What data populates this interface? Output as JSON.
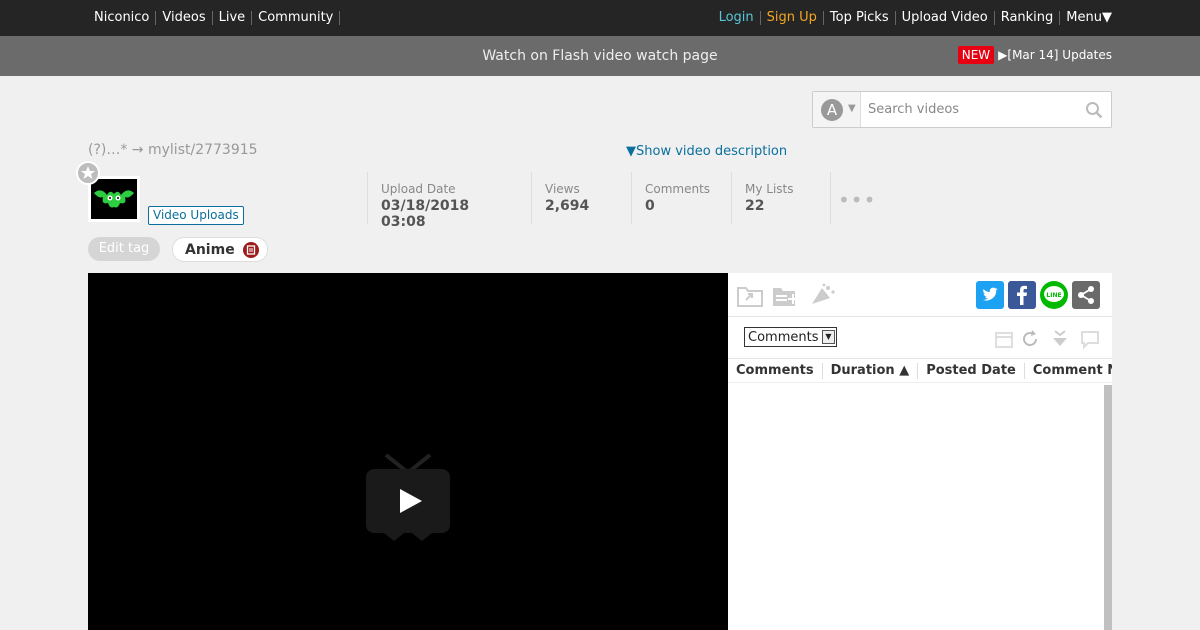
{
  "topnav": {
    "left": [
      "Niconico",
      "Videos",
      "Live",
      "Community"
    ],
    "login": "Login",
    "signup": "Sign Up",
    "right": [
      "Top Picks",
      "Upload Video",
      "Ranking",
      "Menu▼"
    ]
  },
  "subbar": {
    "flash_link": "Watch on Flash video watch page",
    "new_badge": "NEW",
    "updates": "▶[Mar 14] Updates"
  },
  "search": {
    "type_letter": "A",
    "placeholder": "Search videos"
  },
  "video": {
    "mylist_text": "(?)…* → mylist/2773915",
    "description_toggle": "▼Show video description",
    "uploads_button": "Video Uploads",
    "stats": {
      "upload_date_label": "Upload Date",
      "upload_date": "03/18/2018 03:08",
      "views_label": "Views",
      "views": "2,694",
      "comments_label": "Comments",
      "comments": "0",
      "mylists_label": "My Lists",
      "mylists": "22"
    },
    "more": "•••"
  },
  "tags": {
    "edit_label": "Edit tag",
    "items": [
      "Anime"
    ]
  },
  "panel": {
    "select_value": "Comments",
    "columns": [
      "Comments",
      "Duration ▲",
      "Posted Date",
      "Comment Number"
    ]
  },
  "colors": {
    "accent": "#0b6f9e",
    "twitter": "#1da1f2",
    "facebook": "#3b5998",
    "line": "#00b900",
    "share": "#6a6a6a",
    "new_badge": "#e60012"
  }
}
